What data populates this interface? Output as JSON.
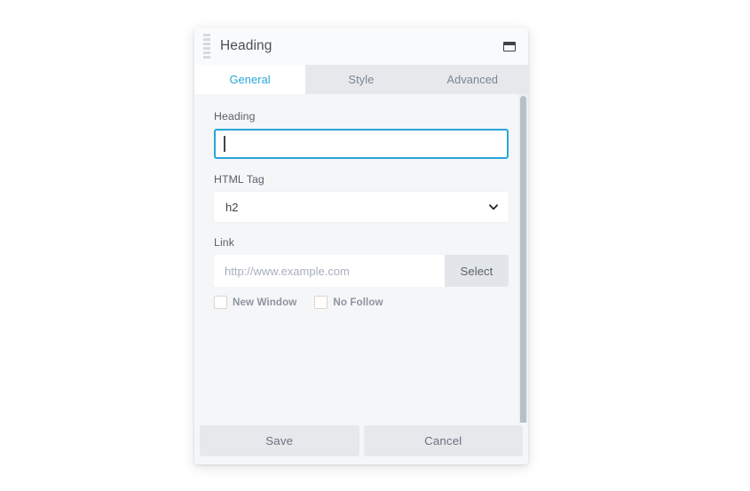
{
  "panel": {
    "title": "Heading",
    "drag_handle_icon": "drag-handle-icon",
    "window_icon": "window-panel-icon"
  },
  "tabs": [
    {
      "label": "General",
      "active": true
    },
    {
      "label": "Style",
      "active": false
    },
    {
      "label": "Advanced",
      "active": false
    }
  ],
  "fields": {
    "heading": {
      "label": "Heading",
      "value": "",
      "placeholder": "",
      "focused": true
    },
    "html_tag": {
      "label": "HTML Tag",
      "value": "h2",
      "chevron_icon": "chevron-down-icon"
    },
    "link": {
      "label": "Link",
      "value": "",
      "placeholder": "http://www.example.com",
      "select_button": "Select"
    },
    "checkboxes": [
      {
        "label": "New Window",
        "checked": false
      },
      {
        "label": "No Follow",
        "checked": false
      }
    ]
  },
  "footer": {
    "save_label": "Save",
    "cancel_label": "Cancel"
  },
  "colors": {
    "accent": "#29a5db",
    "panel_bg": "#f5f6f8",
    "tab_bar_bg": "#e6e8ec",
    "button_bg": "#e6e8ec",
    "scrollbar_thumb": "#b7bfcb"
  }
}
